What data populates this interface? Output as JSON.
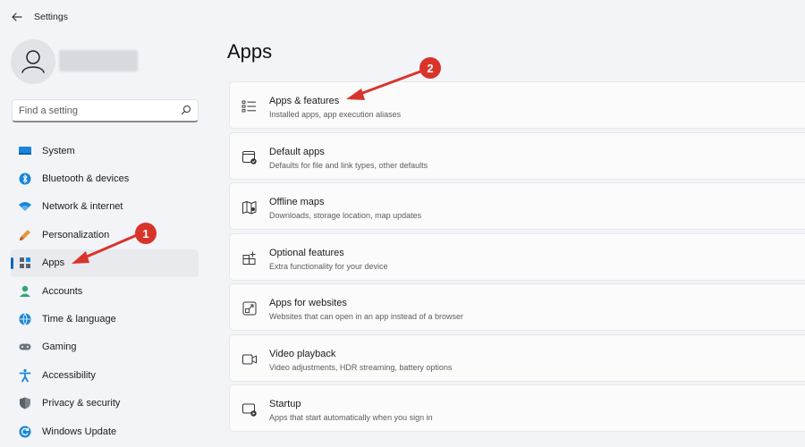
{
  "app": {
    "title": "Settings"
  },
  "search": {
    "placeholder": "Find a setting"
  },
  "sidebar": {
    "items": [
      {
        "label": "System",
        "icon": "monitor-icon"
      },
      {
        "label": "Bluetooth & devices",
        "icon": "bluetooth-icon"
      },
      {
        "label": "Network & internet",
        "icon": "wifi-icon"
      },
      {
        "label": "Personalization",
        "icon": "brush-icon"
      },
      {
        "label": "Apps",
        "icon": "apps-icon",
        "active": true
      },
      {
        "label": "Accounts",
        "icon": "person-icon"
      },
      {
        "label": "Time & language",
        "icon": "globe-icon"
      },
      {
        "label": "Gaming",
        "icon": "gamepad-icon"
      },
      {
        "label": "Accessibility",
        "icon": "accessibility-icon"
      },
      {
        "label": "Privacy & security",
        "icon": "shield-icon"
      },
      {
        "label": "Windows Update",
        "icon": "update-icon"
      }
    ]
  },
  "main": {
    "title": "Apps",
    "cards": [
      {
        "title": "Apps & features",
        "subtitle": "Installed apps, app execution aliases",
        "icon": "list-icon"
      },
      {
        "title": "Default apps",
        "subtitle": "Defaults for file and link types, other defaults",
        "icon": "default-apps-icon"
      },
      {
        "title": "Offline maps",
        "subtitle": "Downloads, storage location, map updates",
        "icon": "map-icon"
      },
      {
        "title": "Optional features",
        "subtitle": "Extra functionality for your device",
        "icon": "add-grid-icon"
      },
      {
        "title": "Apps for websites",
        "subtitle": "Websites that can open in an app instead of a browser",
        "icon": "open-link-icon"
      },
      {
        "title": "Video playback",
        "subtitle": "Video adjustments, HDR streaming, battery options",
        "icon": "video-icon"
      },
      {
        "title": "Startup",
        "subtitle": "Apps that start automatically when you sign in",
        "icon": "startup-icon"
      }
    ]
  },
  "annotations": {
    "badge_1": "1",
    "badge_2": "2",
    "color": "#d9342b"
  }
}
